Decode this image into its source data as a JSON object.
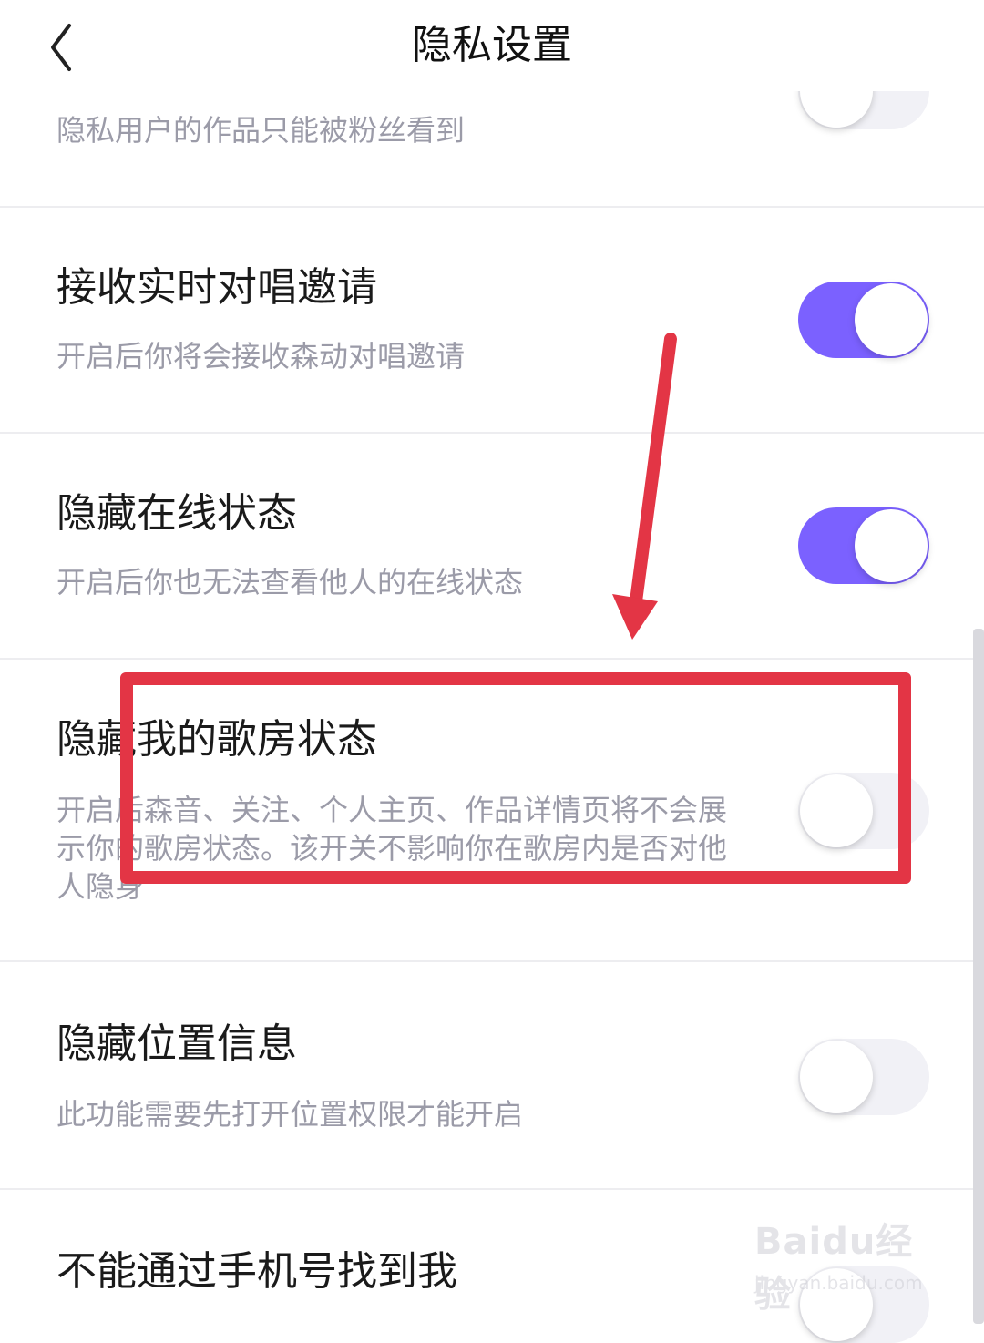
{
  "header": {
    "title": "隐私设置",
    "back_icon": "chevron-left-icon"
  },
  "rows": [
    {
      "title": "",
      "desc": "隐私用户的作品只能被粉丝看到",
      "toggle_on": false
    },
    {
      "title": "接收实时对唱邀请",
      "desc": "开启后你将会接收森动对唱邀请",
      "toggle_on": true
    },
    {
      "title": "隐藏在线状态",
      "desc": "开启后你也无法查看他人的在线状态",
      "toggle_on": true
    },
    {
      "title": "隐藏我的歌房状态",
      "desc": "开启后森音、关注、个人主页、作品详情页将不会展示你的歌房状态。该开关不影响你在歌房内是否对他人隐身",
      "toggle_on": false
    },
    {
      "title": "隐藏位置信息",
      "desc": "此功能需要先打开位置权限才能开启",
      "toggle_on": false
    },
    {
      "title": "不能通过手机号找到我",
      "desc": "",
      "toggle_on": false
    }
  ],
  "colors": {
    "accent": "#7b61ff",
    "annotation": "#e33545",
    "toggle_off": "#f1f1f6"
  },
  "watermark": {
    "logo": "Baidu经验",
    "url": "jingyan.baidu.com"
  }
}
